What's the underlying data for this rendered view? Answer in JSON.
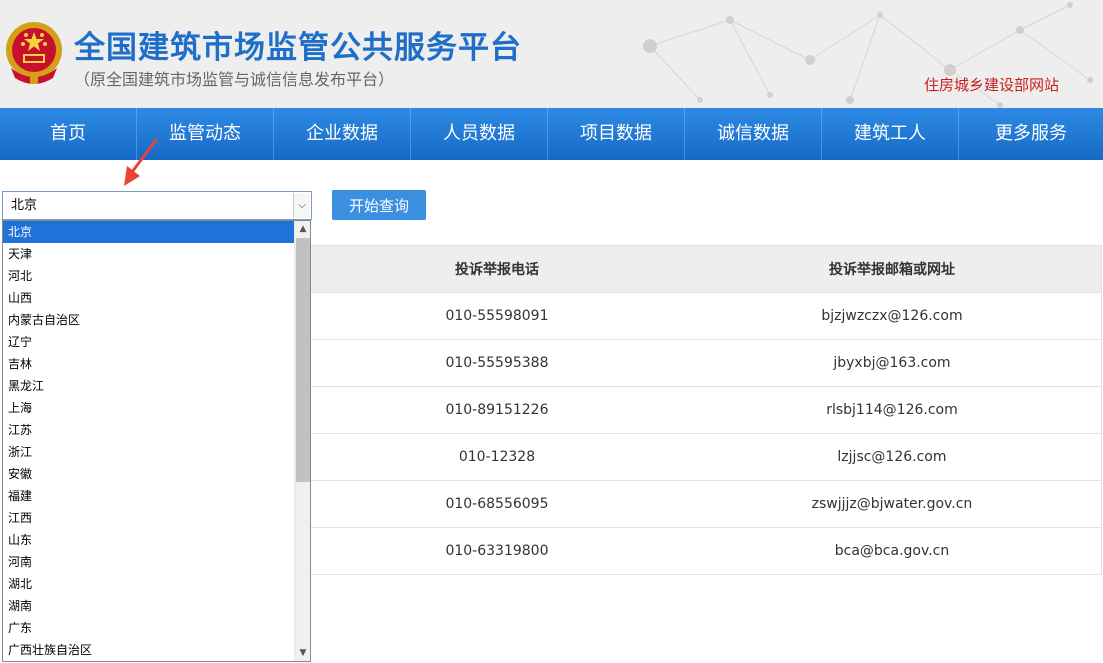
{
  "header": {
    "title": "全国建筑市场监管公共服务平台",
    "subtitle": "（原全国建筑市场监管与诚信信息发布平台）",
    "ministry_link": "住房城乡建设部网站"
  },
  "nav": {
    "items": [
      "首页",
      "监管动态",
      "企业数据",
      "人员数据",
      "项目数据",
      "诚信数据",
      "建筑工人",
      "更多服务"
    ]
  },
  "search": {
    "selected_province": "北京",
    "query_button": "开始查询"
  },
  "dropdown": {
    "options": [
      "北京",
      "天津",
      "河北",
      "山西",
      "内蒙古自治区",
      "辽宁",
      "吉林",
      "黑龙江",
      "上海",
      "江苏",
      "浙江",
      "安徽",
      "福建",
      "江西",
      "山东",
      "河南",
      "湖北",
      "湖南",
      "广东",
      "广西壮族自治区"
    ]
  },
  "table": {
    "headers": [
      "投诉举报电话",
      "投诉举报邮箱或网址"
    ],
    "rows": [
      [
        "010-55598091",
        "bjzjwzczx@126.com"
      ],
      [
        "010-55595388",
        "jbyxbj@163.com"
      ],
      [
        "010-89151226",
        "rlsbj114@126.com"
      ],
      [
        "010-12328",
        "lzjjsc@126.com"
      ],
      [
        "010-68556095",
        "zswjjjz@bjwater.gov.cn"
      ],
      [
        "010-63319800",
        "bca@bca.gov.cn"
      ]
    ]
  },
  "colors": {
    "brand_blue": "#1f6fc8",
    "nav_blue": "#1769c6",
    "button_blue": "#3b8fe0",
    "ministry_red": "#c81e1e",
    "selected_option": "#1e72d8",
    "annotation_arrow": "#e8423a"
  },
  "icons": {
    "emblem": "national-emblem",
    "select_arrow": "chevron-down-icon",
    "annotation": "red-arrow-icon"
  }
}
